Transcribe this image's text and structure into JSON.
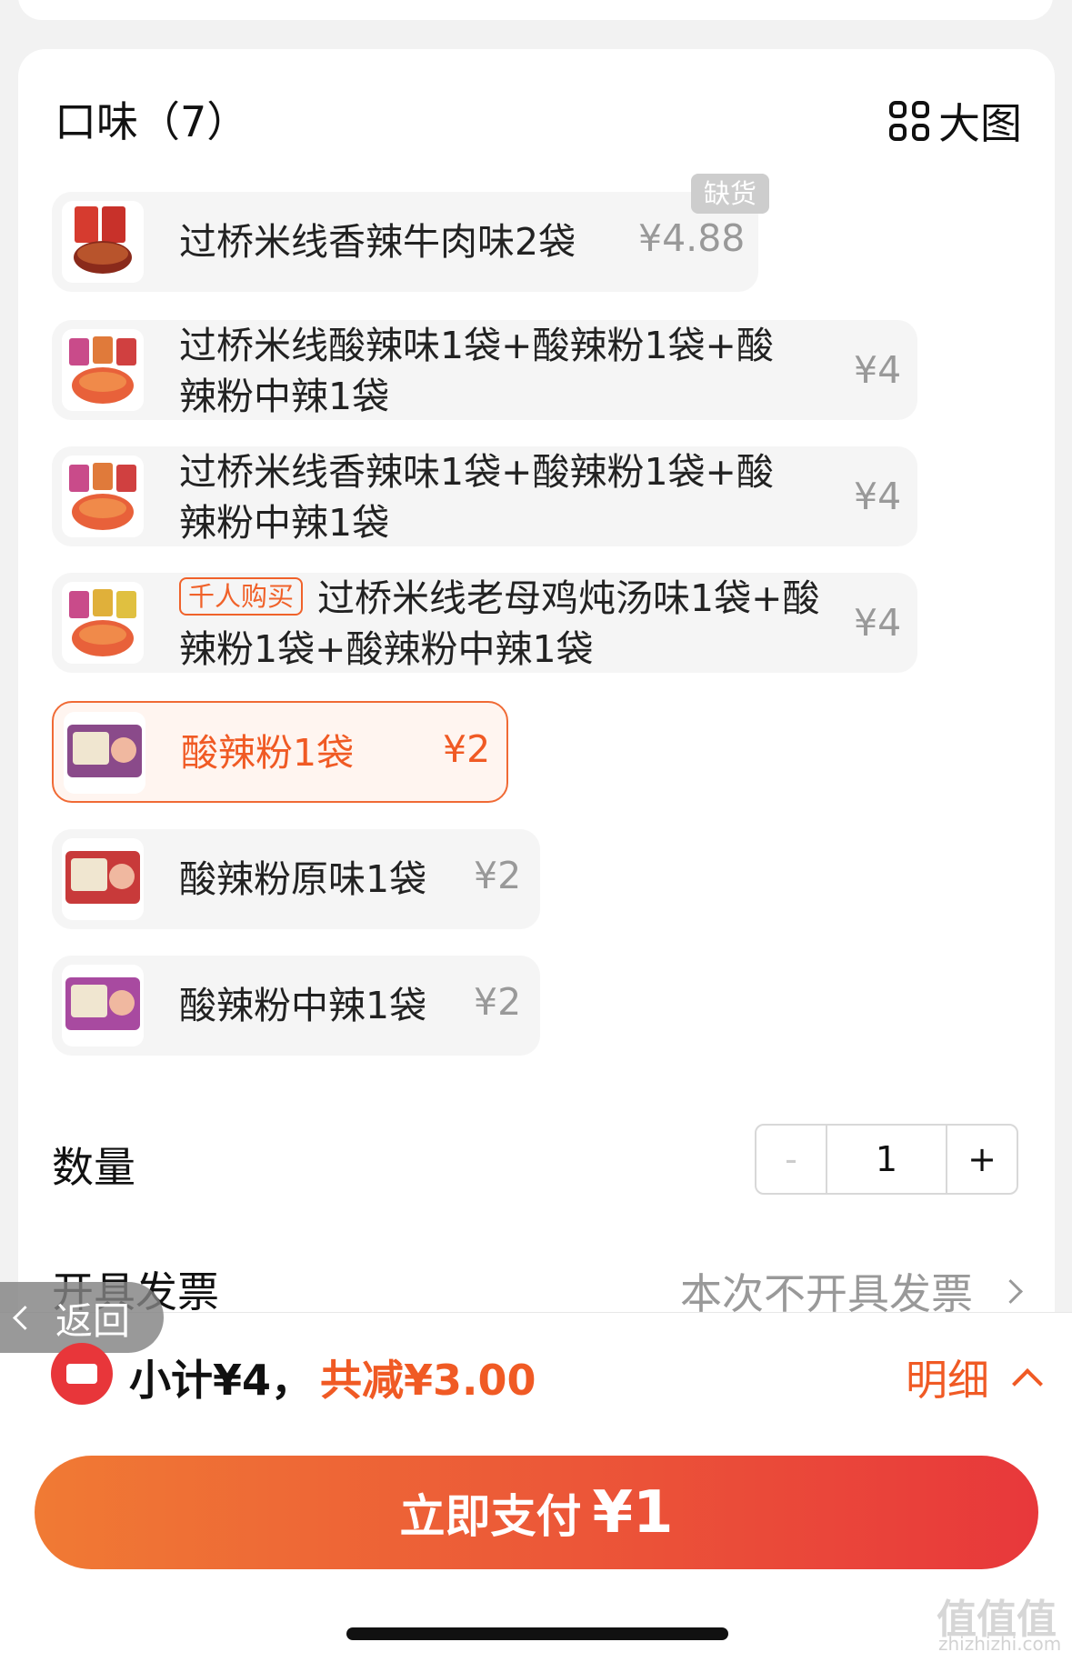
{
  "flavor_section": {
    "title": "口味（7）",
    "big_view_label": "大图",
    "options": [
      {
        "label": "过桥米线香辣牛肉味2袋",
        "price": "¥4.88",
        "badge": "缺货"
      },
      {
        "label": "过桥米线酸辣味1袋+酸辣粉1袋+酸辣粉中辣1袋",
        "price": "¥4"
      },
      {
        "label": "过桥米线香辣味1袋+酸辣粉1袋+酸辣粉中辣1袋",
        "price": "¥4"
      },
      {
        "tag": "千人购买",
        "label": "过桥米线老母鸡炖汤味1袋+酸辣粉1袋+酸辣粉中辣1袋",
        "price": "¥4"
      },
      {
        "label": "酸辣粉1袋",
        "price": "¥2",
        "selected": true
      },
      {
        "label": "酸辣粉原味1袋",
        "price": "¥2"
      },
      {
        "label": "酸辣粉中辣1袋",
        "price": "¥2"
      }
    ]
  },
  "quantity": {
    "label": "数量",
    "minus": "-",
    "value": "1",
    "plus": "+"
  },
  "invoice": {
    "label": "开具发票",
    "value": "本次不开具发票"
  },
  "back_button": {
    "label": "返回"
  },
  "summary": {
    "subtotal": "小计¥4，",
    "discount": "共减¥3.00",
    "detail_label": "明细"
  },
  "pay_button": {
    "label": "立即支付",
    "amount": "¥1"
  },
  "watermark": {
    "text": "值值值",
    "sub": "zhizhizhi.com"
  },
  "colors": {
    "accent": "#f05a24",
    "danger": "#e8363a",
    "gradient_start": "#f07a34",
    "gradient_end": "#e8383b"
  }
}
